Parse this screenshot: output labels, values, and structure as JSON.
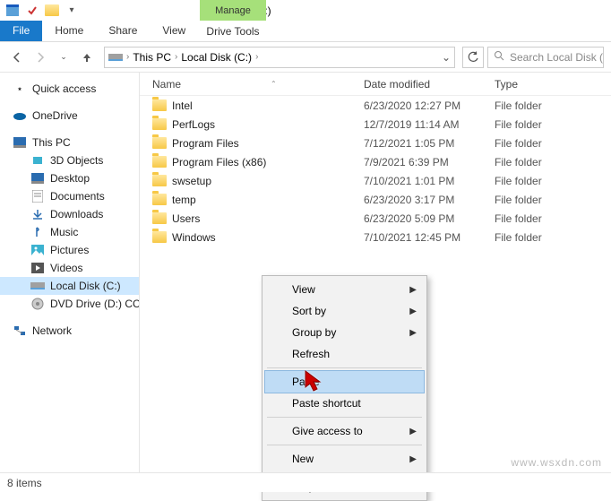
{
  "window": {
    "title": "Local Disk (C:)",
    "context_tab_header": "Manage",
    "context_tab": "Drive Tools"
  },
  "ribbon": {
    "file": "File",
    "home": "Home",
    "share": "Share",
    "view": "View"
  },
  "breadcrumb": {
    "root": "This PC",
    "loc": "Local Disk (C:)"
  },
  "search": {
    "placeholder": "Search Local Disk (C:)"
  },
  "nav": {
    "quick": "Quick access",
    "onedrive": "OneDrive",
    "thispc": "This PC",
    "children": [
      {
        "label": "3D Objects"
      },
      {
        "label": "Desktop"
      },
      {
        "label": "Documents"
      },
      {
        "label": "Downloads"
      },
      {
        "label": "Music"
      },
      {
        "label": "Pictures"
      },
      {
        "label": "Videos"
      },
      {
        "label": "Local Disk (C:)"
      },
      {
        "label": "DVD Drive (D:) CCSA"
      }
    ],
    "network": "Network"
  },
  "columns": {
    "name": "Name",
    "date": "Date modified",
    "type": "Type"
  },
  "files": [
    {
      "name": "Intel",
      "date": "6/23/2020 12:27 PM",
      "type": "File folder"
    },
    {
      "name": "PerfLogs",
      "date": "12/7/2019 11:14 AM",
      "type": "File folder"
    },
    {
      "name": "Program Files",
      "date": "7/12/2021 1:05 PM",
      "type": "File folder"
    },
    {
      "name": "Program Files (x86)",
      "date": "7/9/2021 6:39 PM",
      "type": "File folder"
    },
    {
      "name": "swsetup",
      "date": "7/10/2021 1:01 PM",
      "type": "File folder"
    },
    {
      "name": "temp",
      "date": "6/23/2020 3:17 PM",
      "type": "File folder"
    },
    {
      "name": "Users",
      "date": "6/23/2020 5:09 PM",
      "type": "File folder"
    },
    {
      "name": "Windows",
      "date": "7/10/2021 12:45 PM",
      "type": "File folder"
    }
  ],
  "context_menu": {
    "view": "View",
    "sort": "Sort by",
    "group": "Group by",
    "refresh": "Refresh",
    "paste": "Paste",
    "paste_shortcut": "Paste shortcut",
    "give_access": "Give access to",
    "new": "New",
    "properties": "Properties"
  },
  "status": {
    "items": "8 items"
  },
  "watermark": "www.wsxdn.com"
}
